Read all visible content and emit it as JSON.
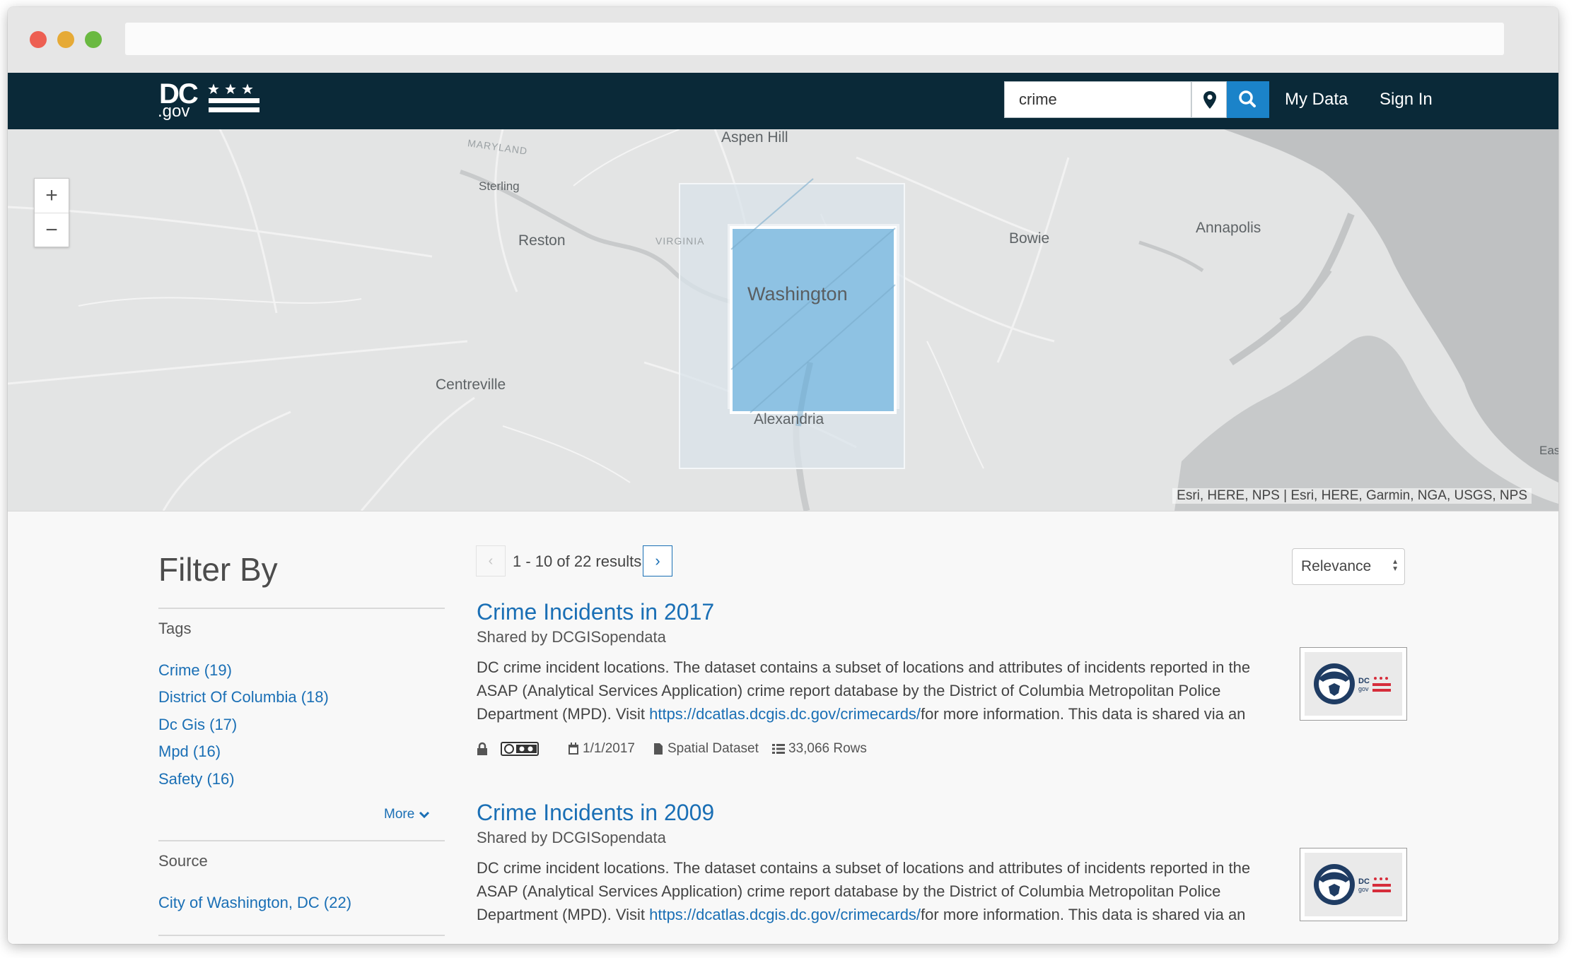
{
  "navbar": {
    "logo_text": "DC",
    "logo_sub": ".gov",
    "search_value": "crime",
    "my_data": "My Data",
    "sign_in": "Sign In"
  },
  "map": {
    "zoom_in": "+",
    "zoom_out": "−",
    "labels": {
      "aspen_hill": "Aspen Hill",
      "maryland": "MARYLAND",
      "sterling": "Sterling",
      "reston": "Reston",
      "virginia": "VIRGINIA",
      "bowie": "Bowie",
      "annapolis": "Annapolis",
      "washington": "Washington",
      "centreville": "Centreville",
      "alexandria": "Alexandria",
      "east": "East"
    },
    "attribution": "Esri, HERE, NPS | Esri, HERE, Garmin, NGA, USGS, NPS"
  },
  "filter": {
    "title": "Filter By",
    "tags_label": "Tags",
    "tags": [
      "Crime (19)",
      "District Of Columbia (18)",
      "Dc Gis (17)",
      "Mpd (16)",
      "Safety (16)"
    ],
    "more": "More",
    "source_label": "Source",
    "sources": [
      "City of Washington, DC (22)"
    ]
  },
  "results": {
    "prev": "‹",
    "next": "›",
    "count": "1 - 10 of 22 results",
    "sort": "Relevance",
    "items": [
      {
        "title": "Crime Incidents in 2017",
        "shared": "Shared by DCGISopendata",
        "desc_before": "DC crime incident locations. The dataset contains a subset of locations and attributes of incidents reported in the ASAP (Analytical Services Application) crime report database by the District of Columbia Metropolitan Police Department (MPD). Visit ",
        "desc_link": "https://dcatlas.dcgis.dc.gov/crimecards/",
        "desc_after": "for more information. This data is shared via an",
        "date": "1/1/2017",
        "type": "Spatial Dataset",
        "rows": "33,066 Rows"
      },
      {
        "title": "Crime Incidents in 2009",
        "shared": "Shared by DCGISopendata",
        "desc_before": "DC crime incident locations. The dataset contains a subset of locations and attributes of incidents reported in the ASAP (Analytical Services Application) crime report database by the District of Columbia Metropolitan Police Department (MPD). Visit ",
        "desc_link": "https://dcatlas.dcgis.dc.gov/crimecards/",
        "desc_after": "for more information. This data is shared via an"
      }
    ]
  },
  "colors": {
    "navbar": "#0a2938",
    "accent": "#1b83c9",
    "link": "#1a6fb5",
    "highlight": "#8ec2e3"
  }
}
